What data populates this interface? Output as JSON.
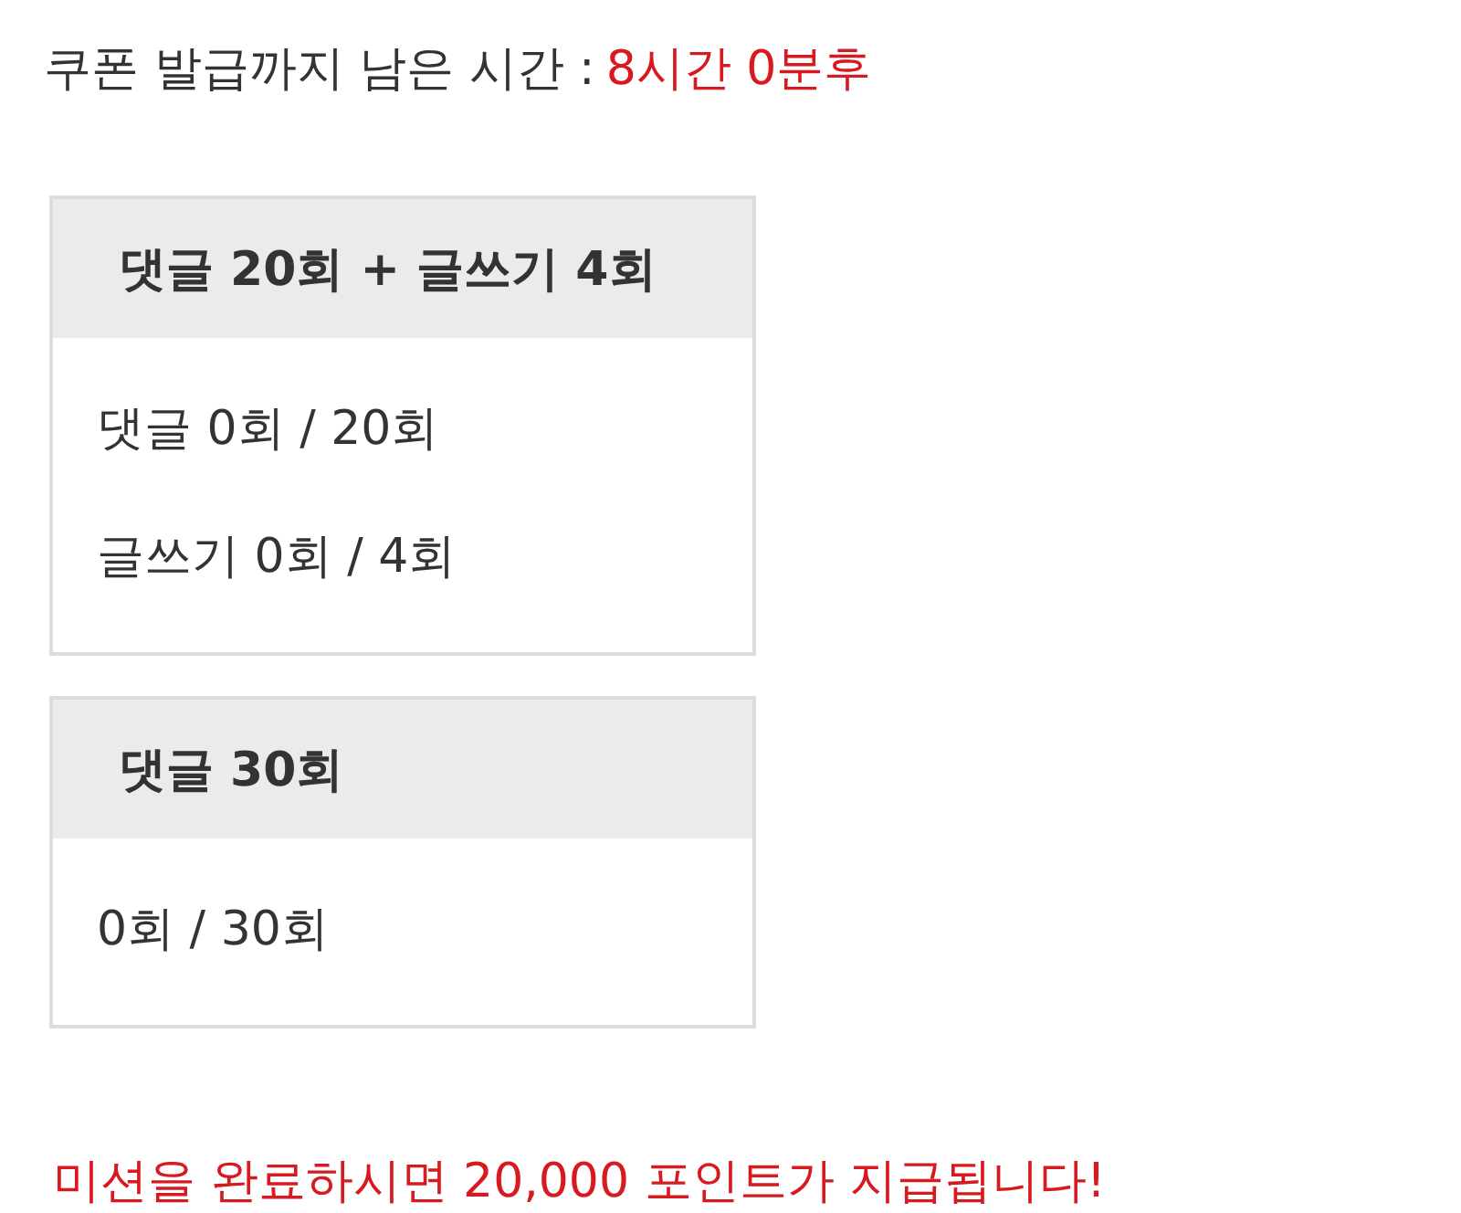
{
  "countdown": {
    "label": "쿠폰 발급까지 남은 시간 :",
    "value": "8시간 0분후"
  },
  "missions": [
    {
      "title": "댓글 20회 + 글쓰기 4회",
      "lines": [
        "댓글 0회 / 20회",
        "글쓰기 0회 / 4회"
      ]
    },
    {
      "title": "댓글 30회",
      "lines": [
        "0회 / 30회"
      ]
    }
  ],
  "notice": "미션을 완료하시면 20,000 포인트가 지급됩니다!"
}
